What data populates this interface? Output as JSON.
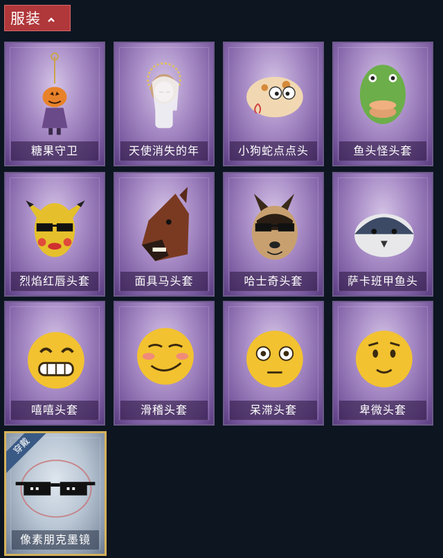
{
  "header": {
    "title": "服装"
  },
  "items": [
    {
      "label": "糖果守卫",
      "icon": "pumpkin-doll-icon"
    },
    {
      "label": "天使消失的年",
      "icon": "angel-girl-icon"
    },
    {
      "label": "小狗蛇点点头",
      "icon": "snake-head-icon"
    },
    {
      "label": "鱼头怪头套",
      "icon": "fish-head-icon"
    },
    {
      "label": "烈焰红唇头套",
      "icon": "pikachu-head-icon"
    },
    {
      "label": "面具马头套",
      "icon": "horse-mask-icon"
    },
    {
      "label": "哈士奇头套",
      "icon": "husky-head-icon"
    },
    {
      "label": "萨卡班甲鱼头",
      "icon": "sacabambaspis-head-icon"
    },
    {
      "label": "嘻嘻头套",
      "icon": "grin-emoji-icon"
    },
    {
      "label": "滑稽头套",
      "icon": "smirk-emoji-icon"
    },
    {
      "label": "呆滞头套",
      "icon": "stare-emoji-icon"
    },
    {
      "label": "卑微头套",
      "icon": "humble-emoji-icon"
    },
    {
      "label": "像素朋克墨镜",
      "icon": "pixel-sunglasses-icon",
      "equipped": true,
      "badge": "穿戴"
    }
  ],
  "colors": {
    "header_bg": "#b0373a",
    "card_purple": "#a88cc6",
    "equipped_border": "#d6b25a",
    "page_bg": "#0d1521"
  }
}
